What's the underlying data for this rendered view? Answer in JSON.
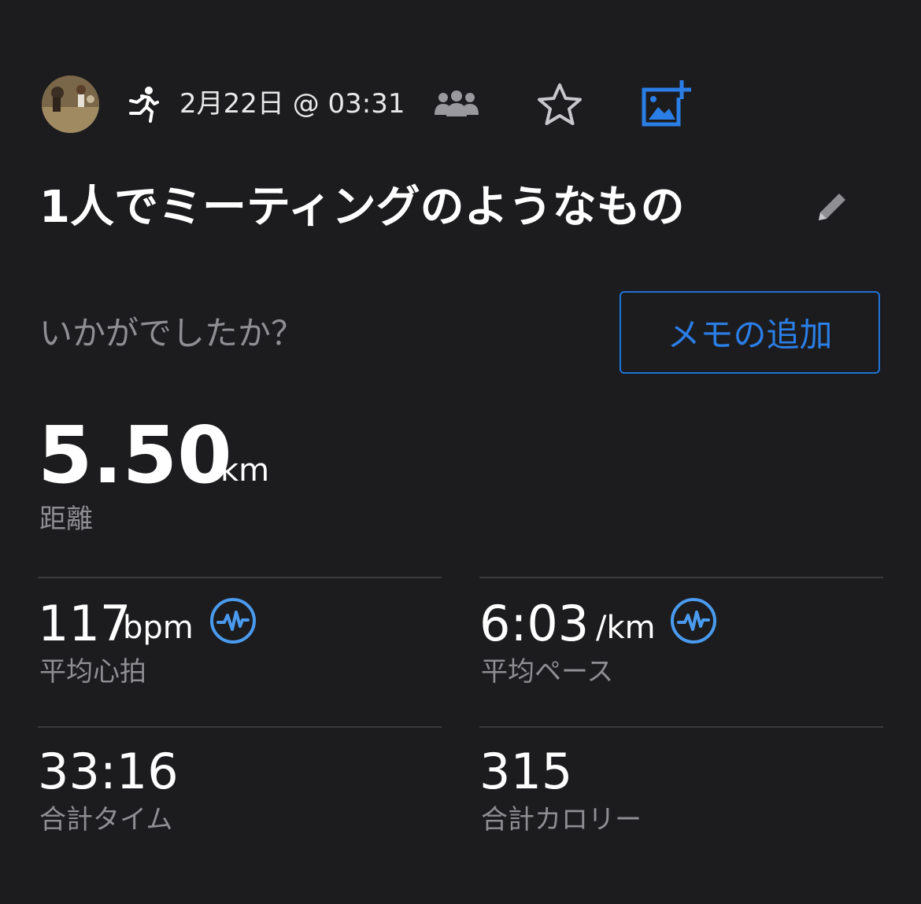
{
  "header": {
    "date_time": "2月22日 @ 03:31"
  },
  "activity": {
    "title": "1人でミーティングのようなもの",
    "prompt": "いかがでしたか？",
    "memo_button_label": "メモの追加"
  },
  "distance": {
    "value": "5.50",
    "unit": "km",
    "label": "距離"
  },
  "stats": {
    "avg_hr": {
      "value": "117",
      "unit": "bpm",
      "label": "平均心拍"
    },
    "avg_pace": {
      "value": "6:03",
      "unit": "/km",
      "label": "平均ペース"
    },
    "total_time": {
      "value": "33:16",
      "label": "合計タイム"
    },
    "total_calories": {
      "value": "315",
      "label": "合計カロリー"
    }
  },
  "icons": {
    "activity_type": "running-icon",
    "group": "group-icon",
    "favorite": "star-icon",
    "add_photo": "add-photo-icon",
    "edit": "pencil-icon",
    "stat_detail": "heart-rate-icon"
  },
  "colors": {
    "background": "#1c1c1e",
    "accent": "#2a7ee6",
    "secondary_text": "#8e8e93"
  }
}
